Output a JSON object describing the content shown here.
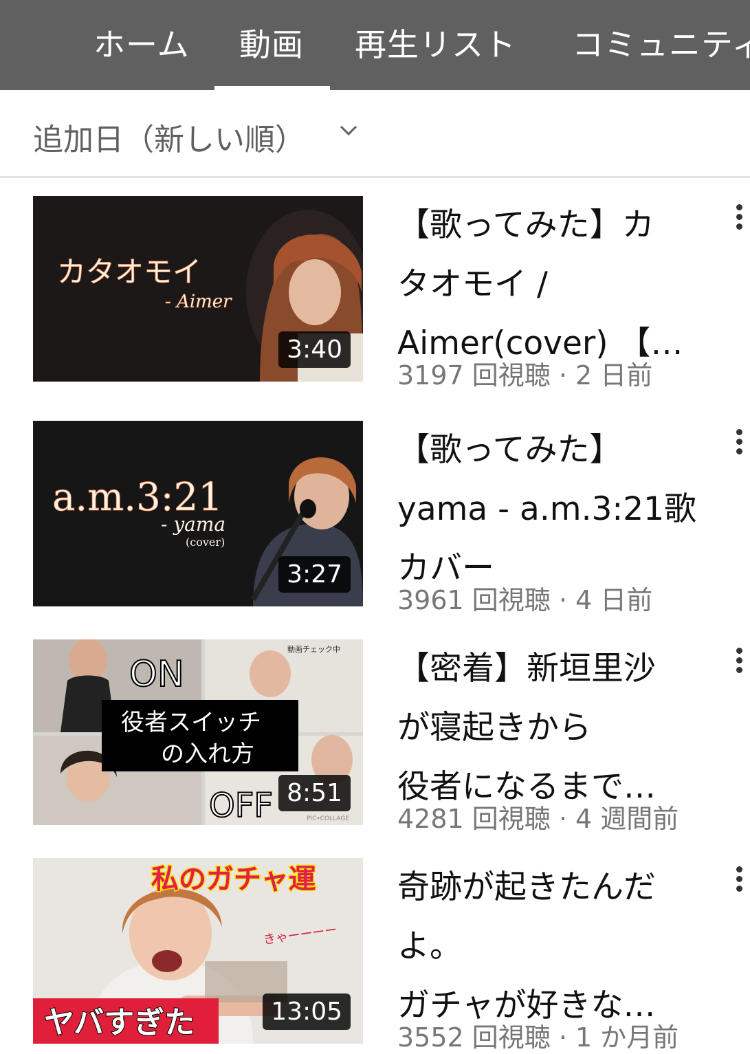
{
  "tabs": [
    "ホーム",
    "動画",
    "再生リスト",
    "コミュニティ"
  ],
  "active_tab": "動画",
  "sort": {
    "label": "追加日（新しい順）"
  },
  "videos": [
    {
      "title_lines": [
        "【歌ってみた】カ",
        "タオモイ /",
        "Aimer(cover) 【…"
      ],
      "duration": "3:40",
      "views": "3197 回視聴",
      "age": "2 日前",
      "thumb_text": [
        "カタオモイ",
        "- Aimer"
      ]
    },
    {
      "title_lines": [
        "【歌ってみた】",
        "yama - a.m.3:21歌",
        "カバー"
      ],
      "duration": "3:27",
      "views": "3961 回視聴",
      "age": "4 日前",
      "thumb_text": [
        "a.m.3:21",
        "- yama",
        "(cover)"
      ]
    },
    {
      "title_lines": [
        "【密着】新垣里沙",
        "が寝起きから",
        "役者になるまで…"
      ],
      "duration": "8:51",
      "views": "4281 回視聴",
      "age": "4 週間前",
      "thumb_text": [
        "ON",
        "役者スイッチ",
        "の入れ方",
        "OFF",
        "動画チェック中",
        "PIC•COLLAGE"
      ]
    },
    {
      "title_lines": [
        "奇跡が起きたんだ",
        "よ。",
        "ガチャが好きな…"
      ],
      "duration": "13:05",
      "views": "3552 回視聴",
      "age": "1 か月前",
      "thumb_text": [
        "私のガチャ運",
        "きゃーーーー",
        "ヤバすぎた"
      ]
    }
  ],
  "meta_separator": " · ",
  "colors": {
    "tabbar_bg": "#606060",
    "text_primary": "#111111",
    "text_secondary": "#777777"
  }
}
